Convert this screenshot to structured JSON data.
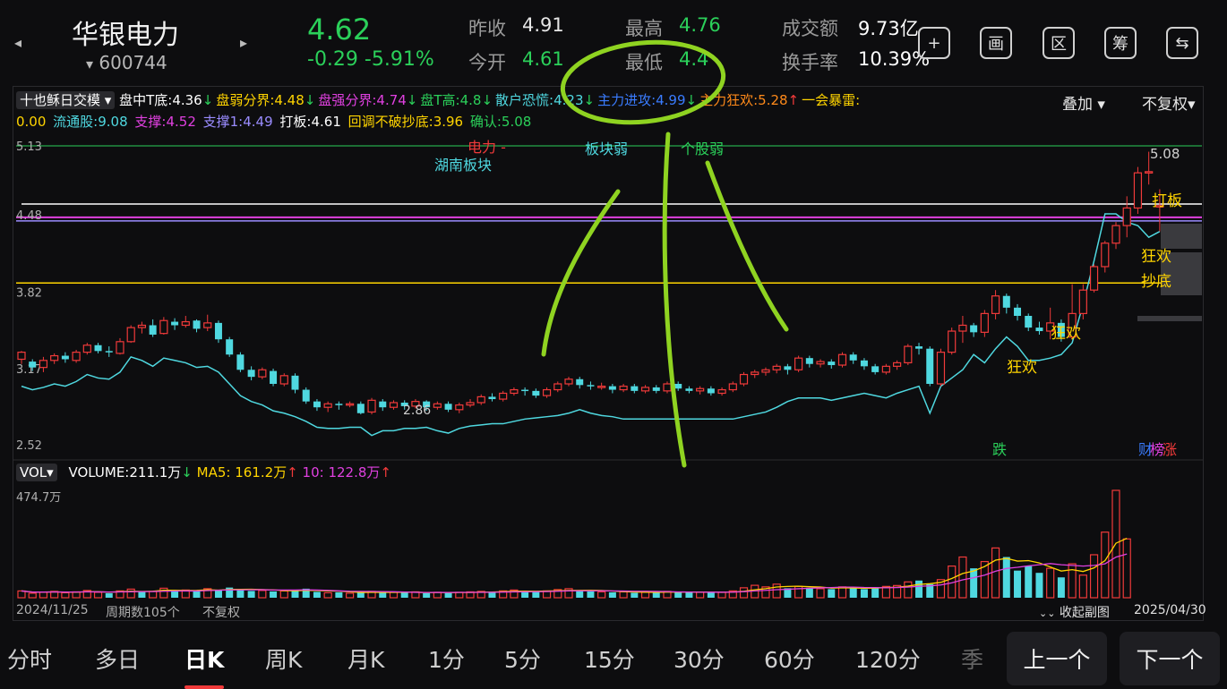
{
  "header": {
    "stock_name": "华银电力",
    "stock_code": "600744",
    "code_caret": "▾",
    "price": "4.62",
    "change": "-0.29  -5.91%",
    "prev_close_label": "昨收",
    "prev_close": "4.91",
    "open_label": "今开",
    "open": "4.61",
    "high_label": "最高",
    "high": "4.76",
    "low_label": "最低",
    "low": "4.4",
    "amount_label": "成交额",
    "amount": "9.73亿",
    "turnover_label": "换手率",
    "turnover": "10.39%",
    "tools": [
      {
        "icon": "plus-icon",
        "glyph": "+"
      },
      {
        "icon": "canvas-icon",
        "glyph": "画"
      },
      {
        "icon": "range-icon",
        "glyph": "区"
      },
      {
        "icon": "chips-icon",
        "glyph": "筹"
      },
      {
        "icon": "device-switch-icon",
        "glyph": "⇆"
      }
    ]
  },
  "indicator": {
    "name": "十也稣日交模",
    "items": [
      {
        "text": "盘中T底:4.36",
        "color": "#ffffff",
        "arrow": "↓",
        "arrow_color": "#2bd05a"
      },
      {
        "text": "盘弱分界:4.48",
        "color": "#ffd400",
        "arrow": "↓",
        "arrow_color": "#2bd05a"
      },
      {
        "text": "盘强分界:4.74",
        "color": "#e040e0",
        "arrow": "↓",
        "arrow_color": "#2bd05a"
      },
      {
        "text": "盘T高:4.8",
        "color": "#2bd05a",
        "arrow": "↓",
        "arrow_color": "#2bd05a"
      },
      {
        "text": "散户恐慌:4.23",
        "color": "#4fd8e0",
        "arrow": "↓",
        "arrow_color": "#2bd05a"
      },
      {
        "text": "主力进攻:4.99",
        "color": "#3a7cff",
        "arrow": "↓",
        "arrow_color": "#2bd05a"
      },
      {
        "text": "主力狂欢:5.28",
        "color": "#ff8a1a",
        "arrow": "↑",
        "arrow_color": "#f03a3a"
      },
      {
        "text": "一会暴雷:",
        "color": "#ffd400",
        "arrow": "",
        "arrow_color": ""
      }
    ],
    "items2": [
      {
        "text": "0.00",
        "color": "#ffd400"
      },
      {
        "text": "流通股:9.08",
        "color": "#4fd8e0"
      },
      {
        "text": "支撑:4.52",
        "color": "#e040e0"
      },
      {
        "text": "支撑1:4.49",
        "color": "#9a8cff"
      },
      {
        "text": "打板:4.61",
        "color": "#ffffff"
      },
      {
        "text": "回调不破抄底:3.96",
        "color": "#ffd400"
      },
      {
        "text": "确认:5.08",
        "color": "#2bd05a"
      }
    ],
    "overlay_label": "叠加",
    "adjust_label": "不复权"
  },
  "price_axis": [
    "5.13",
    "4.48",
    "3.82",
    "3.17",
    "2.52"
  ],
  "chart_labels": {
    "sector": "电力 -",
    "region": "湖南板块",
    "sector_weak": "板块弱",
    "stock_weak": "个股弱",
    "high_mark": "5.08",
    "low_mark": "2.86",
    "daban": "打板",
    "kuanghuan": "狂欢",
    "chaodi": "抄底",
    "kuanghuan2": "狂欢",
    "kuanghuan3": "狂欢",
    "die": "跌",
    "caibao": "财",
    "zhang": "涨",
    "bang": "榜"
  },
  "volume": {
    "name": "VOL",
    "volume": "VOLUME:211.1万",
    "ma5": "MA5: 161.2万",
    "ma10": "10: 122.8万",
    "max": "474.7万"
  },
  "footer_info": {
    "start_date": "2024/11/25",
    "period_count": "周期数105个",
    "adjust": "不复权",
    "collapse": "收起副图",
    "end_date": "2025/04/30"
  },
  "tabs": [
    "分时",
    "多日",
    "日K",
    "周K",
    "月K",
    "1分",
    "5分",
    "15分",
    "30分",
    "60分",
    "120分",
    "季"
  ],
  "active_tab": "日K",
  "prev_label": "上一个",
  "next_label": "下一个",
  "colors": {
    "up": "#f03a3a",
    "down": "#2bd05a",
    "down_candle": "#4fd8e0",
    "accent": "#f03a3a",
    "annotation": "#8fd321"
  },
  "chart_data": {
    "type": "candlestick",
    "y_axis_ticks": [
      5.13,
      4.48,
      3.82,
      3.17,
      2.52
    ],
    "ylim": [
      2.52,
      5.13
    ],
    "candles": [
      [
        3.31,
        3.37,
        3.27,
        3.38
      ],
      [
        3.29,
        3.24,
        3.21,
        3.31
      ],
      [
        3.24,
        3.3,
        3.2,
        3.33
      ],
      [
        3.3,
        3.34,
        3.27,
        3.36
      ],
      [
        3.34,
        3.31,
        3.28,
        3.37
      ],
      [
        3.3,
        3.37,
        3.28,
        3.39
      ],
      [
        3.37,
        3.43,
        3.35,
        3.45
      ],
      [
        3.43,
        3.38,
        3.36,
        3.45
      ],
      [
        3.38,
        3.37,
        3.33,
        3.42
      ],
      [
        3.36,
        3.46,
        3.35,
        3.49
      ],
      [
        3.46,
        3.58,
        3.45,
        3.6
      ],
      [
        3.58,
        3.6,
        3.53,
        3.63
      ],
      [
        3.6,
        3.52,
        3.5,
        3.65
      ],
      [
        3.53,
        3.64,
        3.52,
        3.67
      ],
      [
        3.63,
        3.6,
        3.56,
        3.66
      ],
      [
        3.6,
        3.63,
        3.58,
        3.68
      ],
      [
        3.64,
        3.57,
        3.54,
        3.65
      ],
      [
        3.58,
        3.62,
        3.55,
        3.69
      ],
      [
        3.62,
        3.48,
        3.45,
        3.64
      ],
      [
        3.48,
        3.35,
        3.33,
        3.5
      ],
      [
        3.35,
        3.22,
        3.2,
        3.37
      ],
      [
        3.22,
        3.16,
        3.13,
        3.25
      ],
      [
        3.16,
        3.22,
        3.14,
        3.24
      ],
      [
        3.21,
        3.1,
        3.08,
        3.23
      ],
      [
        3.1,
        3.17,
        3.08,
        3.19
      ],
      [
        3.17,
        3.05,
        3.02,
        3.19
      ],
      [
        3.05,
        2.95,
        2.93,
        3.07
      ],
      [
        2.95,
        2.9,
        2.87,
        2.97
      ],
      [
        2.9,
        2.93,
        2.86,
        2.95
      ],
      [
        2.93,
        2.92,
        2.88,
        2.95
      ],
      [
        2.92,
        2.93,
        2.9,
        2.95
      ],
      [
        2.93,
        2.85,
        2.84,
        2.95
      ],
      [
        2.86,
        2.96,
        2.84,
        2.98
      ],
      [
        2.95,
        2.9,
        2.87,
        2.97
      ],
      [
        2.9,
        2.94,
        2.88,
        2.96
      ],
      [
        2.94,
        2.91,
        2.88,
        2.96
      ],
      [
        2.91,
        2.95,
        2.89,
        2.97
      ],
      [
        2.95,
        2.9,
        2.87,
        2.96
      ],
      [
        2.9,
        2.93,
        2.88,
        2.95
      ],
      [
        2.93,
        2.88,
        2.86,
        2.95
      ],
      [
        2.88,
        2.92,
        2.85,
        2.94
      ],
      [
        2.92,
        2.94,
        2.9,
        2.97
      ],
      [
        2.94,
        2.99,
        2.92,
        3.01
      ],
      [
        2.99,
        2.97,
        2.95,
        3.02
      ],
      [
        2.97,
        3.02,
        2.95,
        3.04
      ],
      [
        3.02,
        3.05,
        3.0,
        3.07
      ],
      [
        3.05,
        3.04,
        3.0,
        3.07
      ],
      [
        3.04,
        3.0,
        2.98,
        3.06
      ],
      [
        3.0,
        3.05,
        2.98,
        3.07
      ],
      [
        3.05,
        3.1,
        3.03,
        3.12
      ],
      [
        3.1,
        3.14,
        3.08,
        3.16
      ],
      [
        3.14,
        3.09,
        3.06,
        3.16
      ],
      [
        3.09,
        3.08,
        3.05,
        3.12
      ],
      [
        3.08,
        3.08,
        3.05,
        3.11
      ],
      [
        3.08,
        3.05,
        3.02,
        3.1
      ],
      [
        3.05,
        3.08,
        3.03,
        3.1
      ],
      [
        3.08,
        3.04,
        3.02,
        3.1
      ],
      [
        3.04,
        3.07,
        3.02,
        3.09
      ],
      [
        3.07,
        3.04,
        3.02,
        3.09
      ],
      [
        3.04,
        3.1,
        3.02,
        3.12
      ],
      [
        3.1,
        3.06,
        3.04,
        3.12
      ],
      [
        3.06,
        3.04,
        3.02,
        3.08
      ],
      [
        3.04,
        3.06,
        3.01,
        3.08
      ],
      [
        3.06,
        3.02,
        3.0,
        3.08
      ],
      [
        3.02,
        3.05,
        3.0,
        3.07
      ],
      [
        3.05,
        3.1,
        3.03,
        3.12
      ],
      [
        3.1,
        3.18,
        3.08,
        3.2
      ],
      [
        3.18,
        3.2,
        3.15,
        3.22
      ],
      [
        3.2,
        3.22,
        3.17,
        3.24
      ],
      [
        3.22,
        3.25,
        3.19,
        3.27
      ],
      [
        3.25,
        3.22,
        3.18,
        3.27
      ],
      [
        3.22,
        3.32,
        3.2,
        3.34
      ],
      [
        3.32,
        3.27,
        3.24,
        3.34
      ],
      [
        3.27,
        3.29,
        3.24,
        3.31
      ],
      [
        3.29,
        3.26,
        3.23,
        3.31
      ],
      [
        3.26,
        3.35,
        3.24,
        3.37
      ],
      [
        3.35,
        3.3,
        3.27,
        3.37
      ],
      [
        3.3,
        3.25,
        3.22,
        3.32
      ],
      [
        3.25,
        3.2,
        3.18,
        3.27
      ],
      [
        3.2,
        3.25,
        3.18,
        3.27
      ],
      [
        3.25,
        3.28,
        3.22,
        3.3
      ],
      [
        3.28,
        3.42,
        3.26,
        3.44
      ],
      [
        3.42,
        3.4,
        3.35,
        3.45
      ],
      [
        3.4,
        3.1,
        3.08,
        3.42
      ],
      [
        3.1,
        3.37,
        3.08,
        3.4
      ],
      [
        3.37,
        3.55,
        3.35,
        3.58
      ],
      [
        3.55,
        3.6,
        3.45,
        3.68
      ],
      [
        3.6,
        3.54,
        3.5,
        3.62
      ],
      [
        3.54,
        3.7,
        3.5,
        3.73
      ],
      [
        3.7,
        3.85,
        3.65,
        3.9
      ],
      [
        3.85,
        3.75,
        3.7,
        3.87
      ],
      [
        3.75,
        3.68,
        3.64,
        3.78
      ],
      [
        3.68,
        3.58,
        3.55,
        3.7
      ],
      [
        3.58,
        3.55,
        3.52,
        3.63
      ],
      [
        3.55,
        3.62,
        3.48,
        3.75
      ],
      [
        3.62,
        3.5,
        3.46,
        3.65
      ],
      [
        3.5,
        3.7,
        3.48,
        3.95
      ],
      [
        3.7,
        3.9,
        3.65,
        3.95
      ],
      [
        3.9,
        4.1,
        3.88,
        4.12
      ],
      [
        4.1,
        4.3,
        4.05,
        4.32
      ],
      [
        4.3,
        4.45,
        4.25,
        4.48
      ],
      [
        4.45,
        4.6,
        4.35,
        4.7
      ],
      [
        4.6,
        4.9,
        4.55,
        4.95
      ],
      [
        4.9,
        4.91,
        4.8,
        5.08
      ],
      [
        4.61,
        4.62,
        4.4,
        4.76
      ]
    ],
    "blue_line": [
      3.08,
      3.05,
      3.07,
      3.1,
      3.08,
      3.12,
      3.18,
      3.15,
      3.14,
      3.2,
      3.33,
      3.3,
      3.25,
      3.32,
      3.3,
      3.28,
      3.24,
      3.25,
      3.2,
      3.1,
      3.0,
      2.95,
      2.92,
      2.87,
      2.85,
      2.82,
      2.78,
      2.73,
      2.72,
      2.72,
      2.73,
      2.73,
      2.66,
      2.7,
      2.7,
      2.72,
      2.72,
      2.73,
      2.7,
      2.68,
      2.72,
      2.74,
      2.75,
      2.76,
      2.76,
      2.78,
      2.8,
      2.81,
      2.82,
      2.83,
      2.85,
      2.88,
      2.85,
      2.83,
      2.82,
      2.8,
      2.8,
      2.8,
      2.8,
      2.8,
      2.8,
      2.8,
      2.8,
      2.8,
      2.8,
      2.8,
      2.82,
      2.84,
      2.86,
      2.9,
      2.95,
      2.98,
      2.98,
      2.98,
      2.96,
      2.98,
      3.0,
      3.02,
      3.0,
      2.98,
      3.02,
      3.05,
      3.08,
      2.85,
      3.08,
      3.15,
      3.22,
      3.35,
      3.28,
      3.4,
      3.5,
      3.42,
      3.3,
      3.3,
      3.32,
      3.35,
      3.45,
      3.78,
      4.15,
      4.55,
      4.55,
      4.48,
      4.45,
      4.35,
      4.4
    ],
    "volume_max": 474.7,
    "volume_unit": "万",
    "volumes": [
      30,
      20,
      25,
      28,
      22,
      26,
      32,
      24,
      20,
      30,
      38,
      26,
      28,
      42,
      30,
      34,
      28,
      40,
      35,
      45,
      38,
      30,
      32,
      28,
      30,
      34,
      40,
      26,
      22,
      24,
      20,
      25,
      28,
      22,
      24,
      22,
      26,
      20,
      24,
      22,
      24,
      26,
      28,
      26,
      30,
      34,
      28,
      26,
      30,
      36,
      40,
      30,
      28,
      26,
      24,
      26,
      22,
      24,
      24,
      28,
      26,
      24,
      24,
      22,
      24,
      30,
      44,
      55,
      48,
      60,
      42,
      50,
      44,
      40,
      38,
      48,
      46,
      38,
      44,
      50,
      54,
      70,
      76,
      60,
      80,
      140,
      180,
      130,
      160,
      220,
      180,
      120,
      140,
      110,
      130,
      90,
      150,
      100,
      190,
      290,
      474.7,
      260
    ],
    "volume_up_flags": [
      1,
      1,
      1,
      1,
      1,
      1,
      1,
      1,
      0,
      1,
      1,
      0,
      1,
      1,
      0,
      1,
      0,
      1,
      0,
      0,
      0,
      0,
      1,
      0,
      1,
      0,
      0,
      0,
      1,
      0,
      1,
      0,
      1,
      0,
      1,
      0,
      1,
      0,
      1,
      0,
      1,
      1,
      1,
      0,
      1,
      1,
      0,
      0,
      1,
      1,
      1,
      0,
      0,
      1,
      0,
      1,
      0,
      1,
      0,
      1,
      0,
      0,
      1,
      0,
      1,
      1,
      1,
      1,
      1,
      1,
      0,
      1,
      0,
      1,
      0,
      1,
      0,
      0,
      0,
      1,
      1,
      1,
      0,
      0,
      1,
      1,
      1,
      0,
      1,
      1,
      0,
      0,
      0,
      0,
      1,
      0,
      1,
      1,
      1,
      1,
      1,
      1,
      1,
      1,
      0
    ]
  }
}
